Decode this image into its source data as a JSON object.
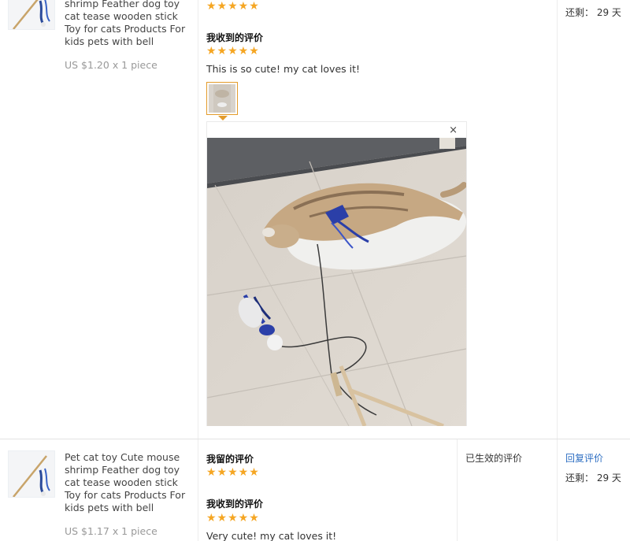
{
  "rows": [
    {
      "product": {
        "title_lines": [
          "shrimp Feather dog toy",
          "cat tease wooden stick",
          "Toy for cats Products For",
          "kids pets with bell"
        ],
        "price": "US $1.20 x 1 piece"
      },
      "my_review": {
        "rating": 5
      },
      "received_review": {
        "label": "我收到的评价",
        "rating": 5,
        "text": "This is so cute! my cat loves it!",
        "photos": 1
      },
      "remaining": {
        "label": "还剩：",
        "value": "29 天"
      }
    },
    {
      "product": {
        "title_lines": [
          "Pet cat toy Cute mouse",
          "shrimp Feather dog toy",
          "cat tease wooden stick",
          "Toy for cats Products For",
          "kids pets with bell"
        ],
        "price": "US $1.17 x 1 piece"
      },
      "my_review": {
        "label": "我留的评价",
        "rating": 5
      },
      "received_review": {
        "label": "我收到的评价",
        "rating": 5,
        "text": "Very cute! my cat loves it!"
      },
      "status": "已生效的评价",
      "reply_link": "回复评价",
      "remaining": {
        "label": "还剩：",
        "value": "29 天"
      }
    }
  ],
  "viewer": {
    "close_symbol": "×"
  },
  "star_glyphs": "★★★★★",
  "colors": {
    "star": "#f5a623",
    "link": "#2d6ec2",
    "thumb_border": "#e39b2b"
  }
}
